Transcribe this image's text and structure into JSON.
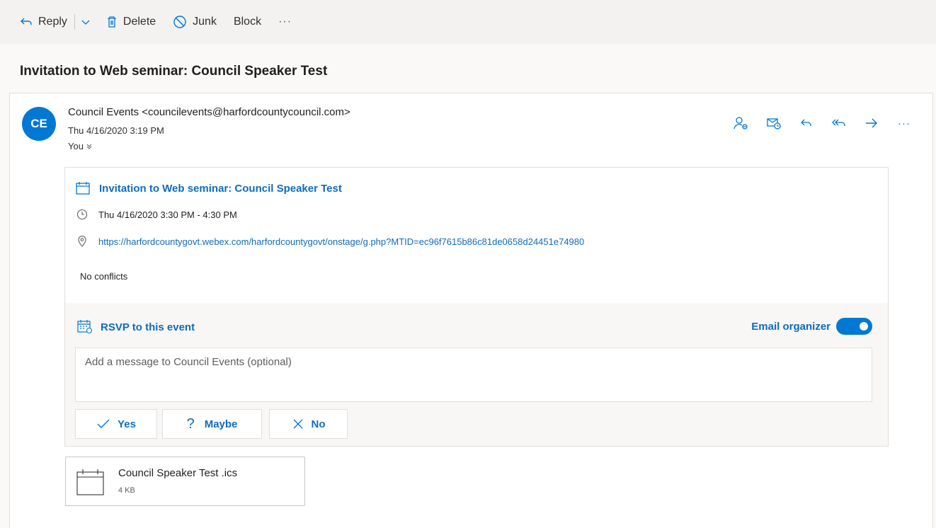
{
  "toolbar": {
    "reply_label": "Reply",
    "delete_label": "Delete",
    "junk_label": "Junk",
    "block_label": "Block",
    "more_label": "···"
  },
  "subject": "Invitation to Web seminar: Council Speaker Test",
  "message": {
    "avatar_initials": "CE",
    "sender": "Council Events <councilevents@harfordcountycouncil.com>",
    "sent_date": "Thu 4/16/2020 3:19 PM",
    "recipient": "You",
    "actions_more": "···"
  },
  "invite": {
    "title": "Invitation to Web seminar: Council Speaker Test",
    "time": "Thu 4/16/2020 3:30 PM - 4:30 PM",
    "location": "https://harfordcountygovt.webex.com/harfordcountygovt/onstage/g.php?MTID=ec96f7615b86c81de0658d24451e74980",
    "conflicts": "No conflicts"
  },
  "rsvp": {
    "label": "RSVP to this event",
    "email_organizer_label": "Email organizer",
    "email_organizer_on": true,
    "message_placeholder": "Add a message to Council Events (optional)",
    "yes_label": "Yes",
    "maybe_label": "Maybe",
    "no_label": "No"
  },
  "attachment": {
    "name": "Council Speaker Test .ics",
    "size": "4 KB"
  },
  "colors": {
    "accent": "#0078d4",
    "link": "#0f6cbd",
    "toolbar_bg": "#f3f2f1"
  }
}
